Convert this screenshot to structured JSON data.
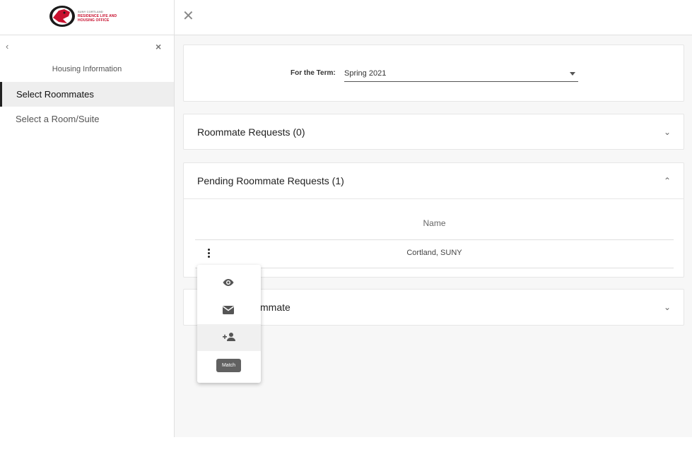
{
  "sidebar": {
    "logo": {
      "line1": "SUNY CORTLAND",
      "line2": "RESIDENCE LIFE AND",
      "line3": "HOUSING OFFICE"
    },
    "section_title": "Housing Information",
    "items": [
      {
        "label": "Select Roommates",
        "active": true
      },
      {
        "label": "Select a Room/Suite",
        "active": false
      }
    ],
    "back_icon": "chevron-left-icon",
    "close_icon": "close-icon"
  },
  "topbar": {
    "close_icon": "close-icon"
  },
  "term": {
    "label": "For the Term:",
    "selected": "Spring 2021"
  },
  "panels": {
    "requests": {
      "title": "Roommate Requests (0)",
      "expanded": false
    },
    "pending": {
      "title": "Pending Roommate Requests (1)",
      "expanded": true,
      "column_header": "Name",
      "rows": [
        {
          "name": "Cortland, SUNY"
        }
      ]
    },
    "add": {
      "title": "mmate",
      "expanded": false
    }
  },
  "popup_menu": {
    "items": [
      "view-icon",
      "email-icon",
      "add-person-icon"
    ],
    "tooltip": "Match"
  },
  "colors": {
    "brand_red": "#c8102e",
    "main_bg": "#f7f7f7",
    "active_item_bg": "#eeeeee"
  }
}
